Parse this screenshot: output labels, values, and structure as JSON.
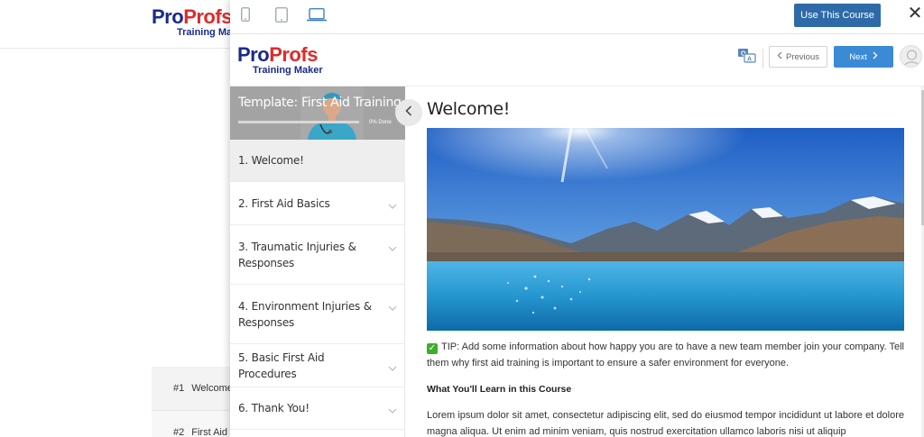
{
  "background_page": {
    "logo": {
      "part1": "Pro",
      "part2": "Profs",
      "sub": "Training Maker"
    },
    "list": [
      {
        "num": "#1",
        "label": "Welcome"
      },
      {
        "num": "#2",
        "label": "First Aid"
      }
    ]
  },
  "toolbar": {
    "devices": [
      "mobile-icon",
      "tablet-icon",
      "laptop-icon"
    ],
    "active_device": "laptop-icon",
    "use_course_label": "Use This Course",
    "close_label": "✕"
  },
  "course_header": {
    "logo": {
      "part1": "Pro",
      "part2": "Profs",
      "sub": "Training Maker"
    },
    "previous_label": "Previous",
    "next_label": "Next"
  },
  "sidebar": {
    "banner_title": "Template: First Aid Training",
    "progress_percent": 0,
    "progress_label": "0% Done",
    "items": [
      {
        "label": "1. Welcome!",
        "active": true,
        "expandable": false
      },
      {
        "label": "2. First Aid Basics",
        "active": false,
        "expandable": true
      },
      {
        "label": "3. Traumatic Injuries & Responses",
        "active": false,
        "expandable": true
      },
      {
        "label": "4. Environment Injuries & Responses",
        "active": false,
        "expandable": true
      },
      {
        "label": "5. Basic First Aid Procedures",
        "active": false,
        "expandable": true
      },
      {
        "label": "6. Thank You!",
        "active": false,
        "expandable": true
      }
    ]
  },
  "content": {
    "title": "Welcome!",
    "tip_text": "TIP: Add some information about how happy you are to have a new team member join your company. Tell them why first aid training is important to ensure a safer environment for everyone.",
    "learn_heading": "What You'll Learn in this Course",
    "lorem_text": "Lorem ipsum dolor sit amet, consectetur adipiscing elit, sed do eiusmod tempor incididunt ut labore et dolore magna aliqua. Ut enim ad minim veniam, quis nostrud exercitation ullamco laboris nisi ut aliquip"
  },
  "colors": {
    "brand_blue": "#1a2a8a",
    "brand_red": "#e02a2a",
    "primary_button": "#2f6aa8",
    "next_button": "#3a8ad6",
    "tip_check": "#3dae2b"
  }
}
